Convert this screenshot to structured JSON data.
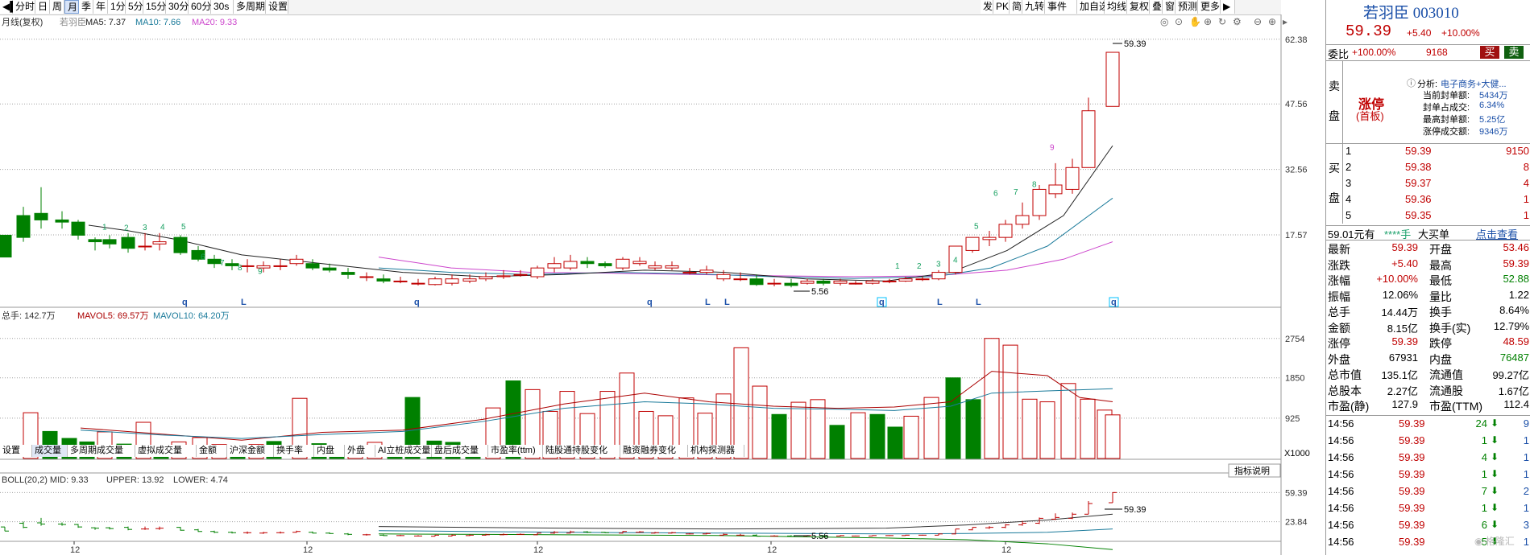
{
  "toolbar_left": [
    "分时",
    "日",
    "周",
    "月",
    "季",
    "年",
    "1分",
    "5分",
    "15分",
    "30分",
    "60分",
    "30s",
    "多周期",
    "设置"
  ],
  "toolbar_selected": "月",
  "toolbar_right": [
    "发",
    "PK",
    "简",
    "九转",
    "事件",
    "加自选",
    "均线",
    "复权",
    "叠",
    "窗",
    "预测",
    "更多"
  ],
  "price_header": {
    "title": "月线(复权)",
    "name": "若羽臣",
    "ma5": "MA5: 7.37",
    "ma10": "MA10: 7.66",
    "ma20": "MA20: 9.33"
  },
  "price_axis": [
    "62.38",
    "47.56",
    "32.56",
    "17.57"
  ],
  "price_annotations": {
    "high": "59.39",
    "low": "5.56"
  },
  "td_down": [
    "1",
    "2",
    "3",
    "4",
    "5",
    "6",
    "7",
    "8",
    "9"
  ],
  "td_up": [
    "1",
    "2",
    "3",
    "4",
    "5",
    "6",
    "7",
    "8",
    "9"
  ],
  "pattern_marks": [
    "q",
    "L",
    "q",
    "q",
    "L",
    "L",
    "q",
    "L",
    "L",
    "q"
  ],
  "volume_header": {
    "label": "总手: 142.7万",
    "mavol5": "MAVOL5: 69.57万",
    "mavol10": "MAVOL10: 64.20万"
  },
  "volume_axis": [
    "2754",
    "1850",
    "925"
  ],
  "volume_unit": "X1000",
  "indicator_tabs": [
    "设置",
    "成交量",
    "多周期成交量",
    "虚拟成交量",
    "金额",
    "沪深金额",
    "换手率",
    "内盘",
    "外盘",
    "AI立桩成交量",
    "盘后成交量",
    "市盈率(ttm)",
    "陆股通持股变化",
    "融资融券变化",
    "机构探测器"
  ],
  "indicator_selected": "成交量",
  "boll_header": {
    "label": "BOLL(20,2) MID: 9.33",
    "upper": "UPPER: 13.92",
    "lower": "LOWER: 4.74"
  },
  "boll_axis": [
    "59.39",
    "23.84"
  ],
  "boll_annotations": {
    "high": "59.39",
    "low": "5.56"
  },
  "indicator_button": "指标说明",
  "x_axis_labels": [
    "12",
    "12",
    "12",
    "12",
    "12"
  ],
  "stock": {
    "name": "若羽臣",
    "code": "003010",
    "price": "59.39",
    "change": "+5.40",
    "pct": "+10.00%"
  },
  "weibi": {
    "label": "委比",
    "pct": "+100.00%",
    "value": "9168",
    "buy_btn": "买",
    "sell_btn": "卖"
  },
  "sell_label": [
    "卖",
    "盘"
  ],
  "limit": {
    "title": "涨停",
    "sub": "(首板)",
    "analysis_label": "分析:",
    "analysis_value": "电子商务+大健...",
    "rows": [
      [
        "当前封单额:",
        "5434万"
      ],
      [
        "封单占成交:",
        "6.34%"
      ],
      [
        "最高封单额:",
        "5.25亿"
      ],
      [
        "涨停成交额:",
        "9346万"
      ]
    ]
  },
  "buy_label": [
    "买",
    "盘"
  ],
  "buy_book": [
    {
      "level": "1",
      "price": "59.39",
      "vol": "9150"
    },
    {
      "level": "2",
      "price": "59.38",
      "vol": "8"
    },
    {
      "level": "3",
      "price": "59.37",
      "vol": "4"
    },
    {
      "level": "4",
      "price": "59.36",
      "vol": "1"
    },
    {
      "level": "5",
      "price": "59.35",
      "vol": "1"
    }
  ],
  "big_order": {
    "a": "59.01元有",
    "b": "****手",
    "c": "大买单",
    "d": "点击查看"
  },
  "quotes": [
    [
      "最新",
      "59.39",
      "开盘",
      "53.46"
    ],
    [
      "涨跌",
      "+5.40",
      "最高",
      "59.39"
    ],
    [
      "涨幅",
      "+10.00%",
      "最低",
      "52.88"
    ],
    [
      "振幅",
      "12.06%",
      "量比",
      "1.22"
    ],
    [
      "总手",
      "14.44万",
      "换手",
      "8.64%"
    ],
    [
      "金额",
      "8.15亿",
      "换手(实)",
      "12.79%"
    ],
    [
      "涨停",
      "59.39",
      "跌停",
      "48.59"
    ],
    [
      "外盘",
      "67931",
      "内盘",
      "76487"
    ],
    [
      "总市值",
      "135.1亿",
      "流通值",
      "99.27亿"
    ],
    [
      "总股本",
      "2.27亿",
      "流通股",
      "1.67亿"
    ],
    [
      "市盈(静)",
      "127.9",
      "市盈(TTM)",
      "112.4"
    ]
  ],
  "ticks": [
    {
      "time": "14:56",
      "price": "59.39",
      "vol": "24",
      "arrow": "down",
      "n": "9"
    },
    {
      "time": "14:56",
      "price": "59.39",
      "vol": "1",
      "arrow": "down",
      "n": "1"
    },
    {
      "time": "14:56",
      "price": "59.39",
      "vol": "4",
      "arrow": "down",
      "n": "1"
    },
    {
      "time": "14:56",
      "price": "59.39",
      "vol": "1",
      "arrow": "down",
      "n": "1"
    },
    {
      "time": "14:56",
      "price": "59.39",
      "vol": "7",
      "arrow": "down",
      "n": "2"
    },
    {
      "time": "14:56",
      "price": "59.39",
      "vol": "1",
      "arrow": "down",
      "n": "1"
    },
    {
      "time": "14:56",
      "price": "59.39",
      "vol": "6",
      "arrow": "down",
      "n": "3"
    },
    {
      "time": "14:56",
      "price": "59.39",
      "vol": "5",
      "arrow": "down",
      "n": "1"
    }
  ],
  "colors": {
    "up": "#c00000",
    "down": "#008000",
    "ma5": "#222222",
    "ma10": "#1a7a9a",
    "ma20": "#cc44cc",
    "grid": "#a0a0a0",
    "highlight": "#00c0ff"
  }
}
